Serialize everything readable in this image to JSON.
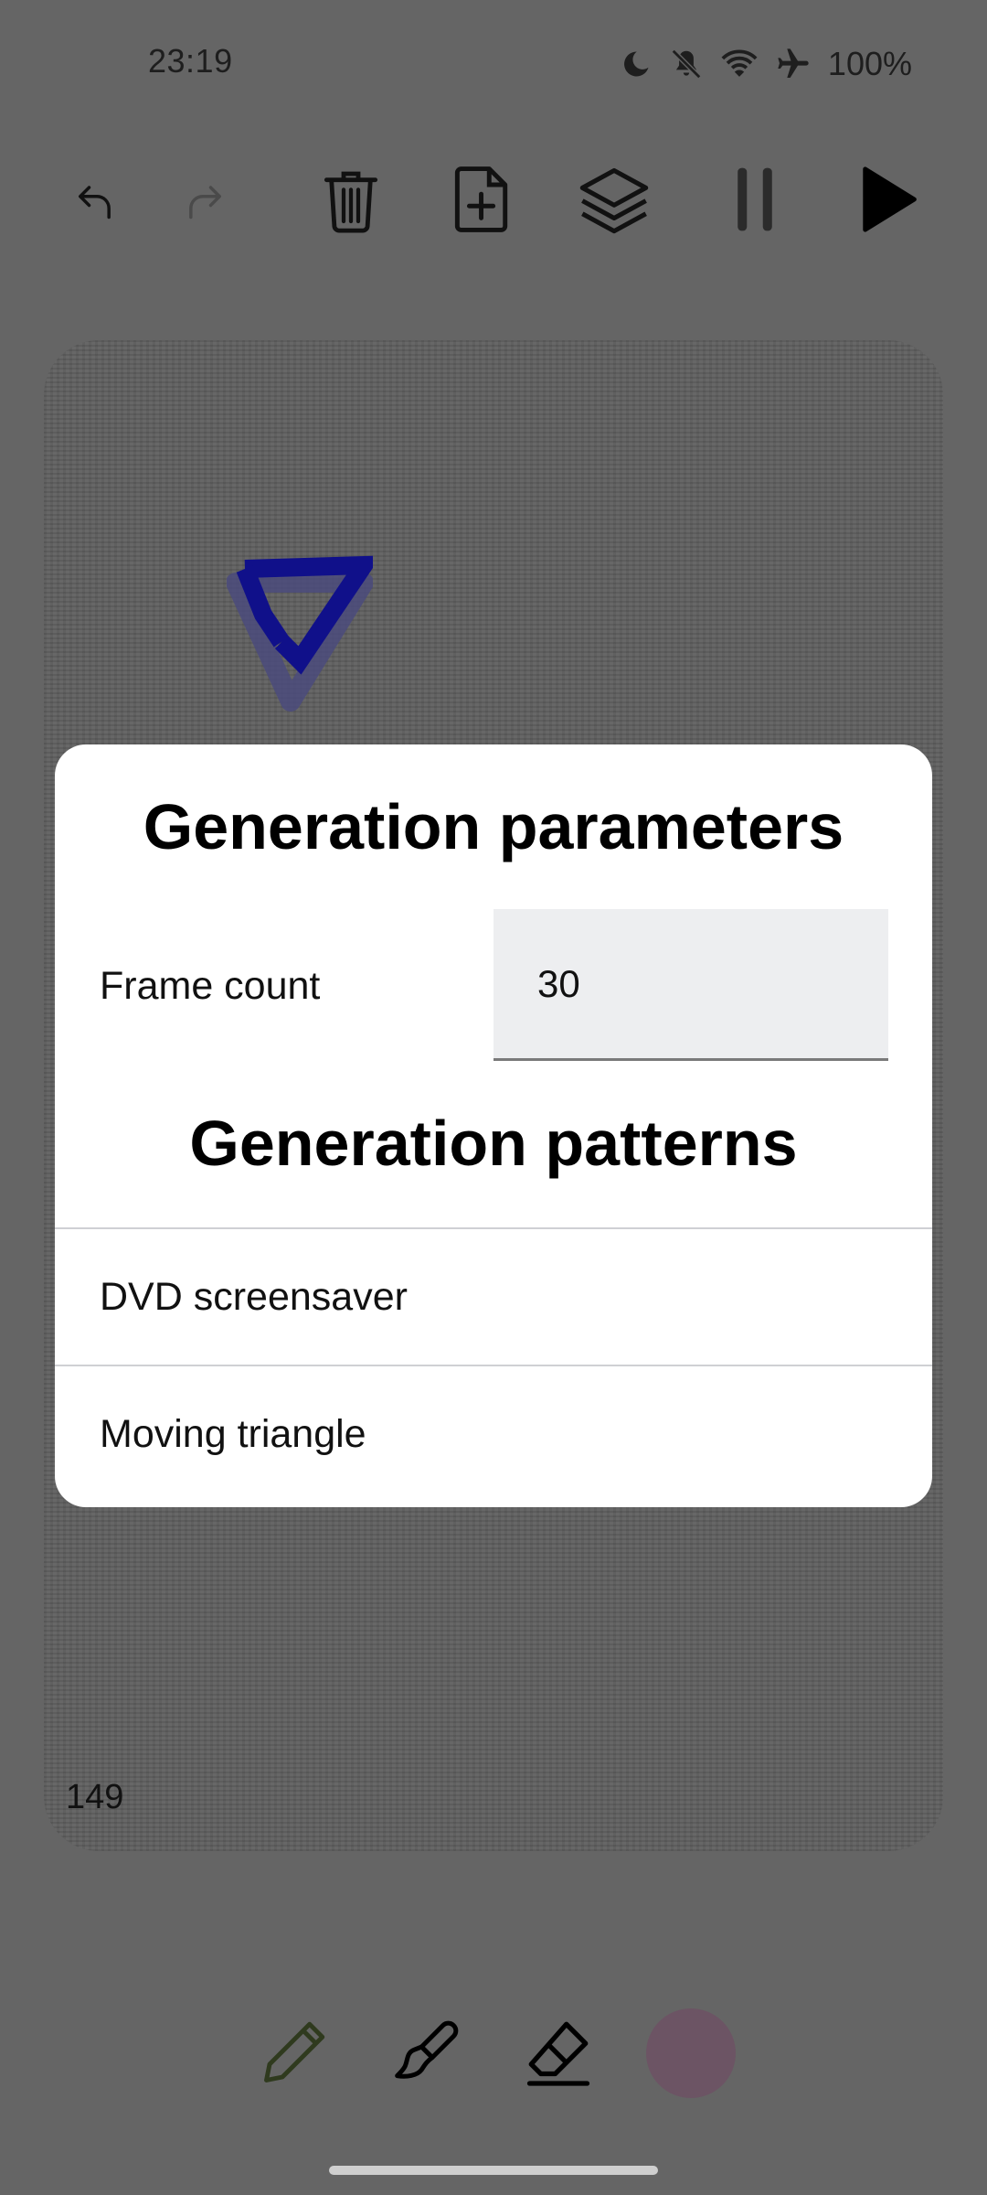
{
  "status_bar": {
    "time": "23:19",
    "battery": "100%",
    "icons": [
      "moon-icon",
      "notifications-off-icon",
      "wifi-icon",
      "airplane-icon"
    ]
  },
  "toolbar": {
    "buttons": [
      "undo-icon",
      "redo-icon",
      "trash-icon",
      "add-file-icon",
      "layers-icon",
      "pause-icon",
      "play-icon"
    ]
  },
  "canvas": {
    "frame_number": "149"
  },
  "dialog": {
    "title": "Generation parameters",
    "frame_count_label": "Frame count",
    "frame_count_value": "30",
    "patterns_title": "Generation patterns",
    "patterns": [
      "DVD screensaver",
      "Moving triangle"
    ]
  },
  "bottom_tools": {
    "tools": [
      "pencil-icon",
      "brush-icon",
      "eraser-icon"
    ],
    "current_color": "#6c5464"
  },
  "colors": {
    "scrim_background": "#656565",
    "dialog_background": "#ffffff",
    "input_background": "#edeef0",
    "triangle_primary": "#10108a"
  }
}
